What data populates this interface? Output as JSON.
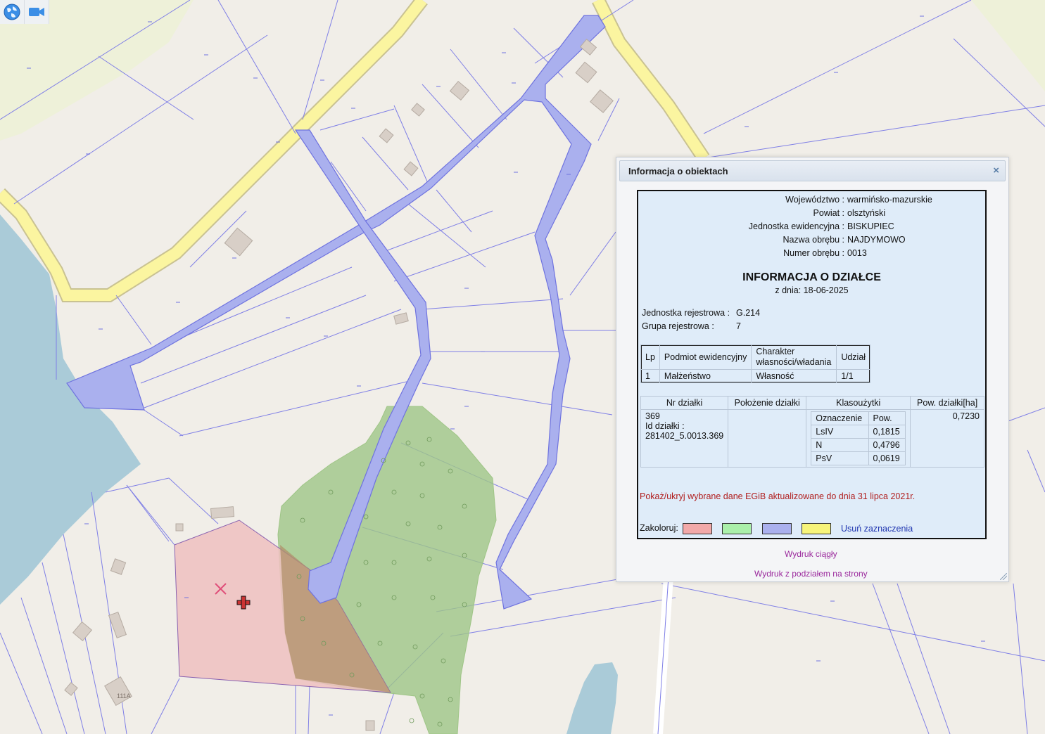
{
  "toolbar": {
    "globe_button": "globe-icon",
    "video_button": "video-camera-icon"
  },
  "map": {
    "house_label": "111A",
    "colors": {
      "background": "#f1eee8",
      "water": "#aacbd8",
      "parcel_line": "#7f7fe6",
      "road_fill": "#aab0ee",
      "main_road": "#fbf5a0",
      "forest": "#9fc587",
      "selected_parcel": "#efbfbf",
      "building": "#d8cfc7",
      "farmland": "#eef1d9"
    }
  },
  "panel": {
    "title": "Informacja o obiektach",
    "close_symbol": "×",
    "admin": [
      {
        "label": "Województwo :",
        "value": "warmińsko-mazurskie"
      },
      {
        "label": "Powiat :",
        "value": "olsztyński"
      },
      {
        "label": "Jednostka ewidencyjna :",
        "value": "BISKUPIEC"
      },
      {
        "label": "Nazwa obrębu :",
        "value": "NAJDYMOWO"
      },
      {
        "label": "Numer obrębu :",
        "value": "0013"
      }
    ],
    "heading": "INFORMACJA O DZIAŁCE",
    "date_line": "z dnia: 18-06-2025",
    "registry_unit_label": "Jednostka rejestrowa :",
    "registry_unit_value": "G.214",
    "registry_group_label": "Grupa rejestrowa :",
    "registry_group_value": "7",
    "owners_table": {
      "headers": [
        "Lp",
        "Podmiot ewidencyjny",
        "Charakter własności/władania",
        "Udział"
      ],
      "rows": [
        [
          "1",
          "Małżeństwo",
          "Własność",
          "1/1"
        ]
      ]
    },
    "parcel_table": {
      "headers": [
        "Nr działki",
        "Położenie działki",
        "Klasoużytki",
        "Pow. działki[ha]"
      ],
      "parcel_number": "369",
      "parcel_id_label": "Id działki :",
      "parcel_id": "281402_5.0013.369",
      "location": "",
      "class_headers": [
        "Oznaczenie",
        "Pow."
      ],
      "classes": [
        [
          "LsIV",
          "0,1815"
        ],
        [
          "N",
          "0,4796"
        ],
        [
          "PsV",
          "0,0619"
        ]
      ],
      "area": "0,7230"
    },
    "egib_link": "Pokaż/ukryj wybrane dane EGiB aktualizowane do dnia 31 lipca 2021r.",
    "color_label": "Zakoloruj:",
    "swatches": [
      "#f2a9a9",
      "#aaf0aa",
      "#aab0ee",
      "#f7f47a"
    ],
    "clear_link": "Usuń zaznaczenia",
    "print_continuous": "Wydruk ciągły",
    "print_pages": "Wydruk z podziałem na strony"
  }
}
